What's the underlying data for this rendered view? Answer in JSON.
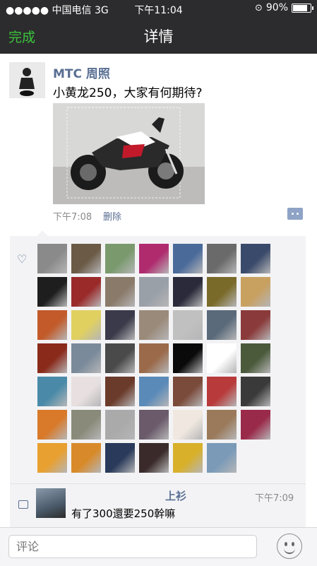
{
  "status": {
    "carrier": "●●●●● 中国电信   3G",
    "time": "下午11:04",
    "battery": "90%",
    "battery_level": 0.9
  },
  "nav": {
    "done_label": "完成",
    "title": "详情"
  },
  "post": {
    "author": "MTC 周照",
    "text": "小黄龙250，大家有何期待?",
    "time": "下午7:08",
    "delete_label": "删除"
  },
  "likes": {
    "colors": [
      "#8a8a8a",
      "#6b5a45",
      "#7a9a6e",
      "#b02a6e",
      "#4a6a9a",
      "#6a6a6a",
      "#3a4a6a",
      "#1e1e1e",
      "#9a2a2a",
      "#8a7a6a",
      "#9aa0a8",
      "#2a2a3a",
      "#7a6a2a",
      "#c8a060",
      "#c25a2a",
      "#e0d060",
      "#3a3a4a",
      "#9a8a7a",
      "#c0c0c0",
      "#5a6a7a",
      "#8a3a3a",
      "#8a2a1a",
      "#7a8a9a",
      "#4a4a4a",
      "#9a6a4a",
      "#0a0a0a",
      "#ffffff",
      "#4a5a3a",
      "#4a8aa8",
      "#e8e0e0",
      "#6a3a2a",
      "#5a8ab8",
      "#7a4a3a",
      "#b83a3a",
      "#3a3a3a",
      "#d87a2a",
      "#8a8a7a",
      "#aaaaaa",
      "#6a5a6a",
      "#f0e8e0",
      "#9a7a5a",
      "#9a2a4a",
      "#e8a030",
      "#d88a2a",
      "#2a3a5a",
      "#3a2a2a",
      "#d8b02a",
      "#7a9ab8"
    ]
  },
  "comment": {
    "name": "上衫",
    "time": "下午7:09",
    "text": "有了300還要250幹嘛",
    "avatar_color": "#4a5a6a"
  },
  "input": {
    "placeholder": "评论"
  }
}
